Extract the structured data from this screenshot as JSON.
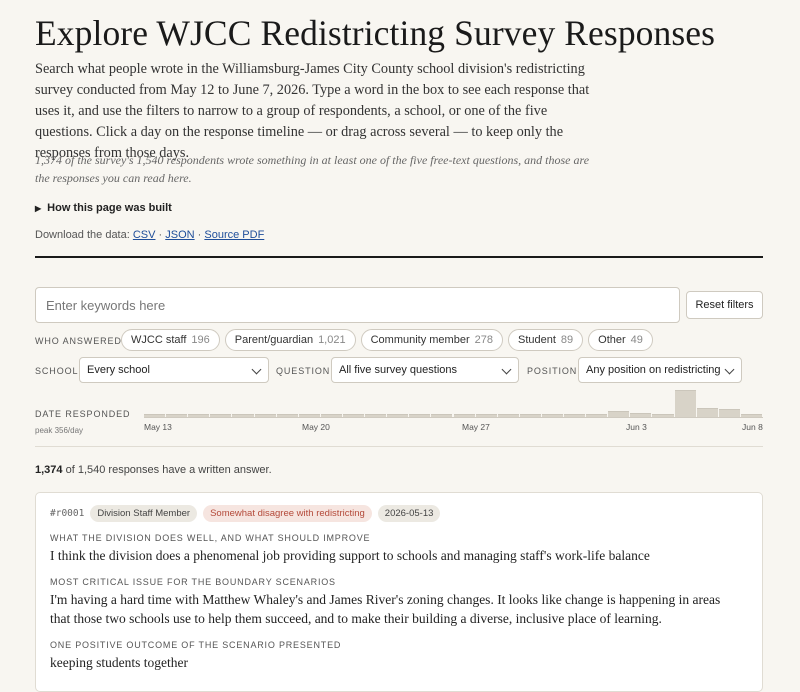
{
  "header": {
    "title": "Explore WJCC Redistricting Survey Responses",
    "intro": "Search what people wrote in the Williamsburg-James City County school division's redistricting survey conducted from May 12 to June 7, 2026. Type a word in the box to see each response that uses it, and use the filters to narrow to a group of respondents, a school, or one of the five questions. Click a day on the response timeline — or drag across several — to keep only the responses from those days.",
    "note": "1,374 of the survey's 1,540 respondents wrote something in at least one of the five free-text questions, and those are the responses you can read here.",
    "how_built": "How this page was built",
    "download_prefix": "Download the data:",
    "download_links": [
      "CSV",
      "JSON",
      "Source PDF"
    ],
    "download_sep": " · "
  },
  "search": {
    "placeholder": "Enter keywords here",
    "value": "",
    "reset_label": "Reset filters"
  },
  "filters": {
    "who_label": "WHO ANSWERED",
    "who_chips": [
      {
        "label": "WJCC staff",
        "count": "196"
      },
      {
        "label": "Parent/guardian",
        "count": "1,021"
      },
      {
        "label": "Community member",
        "count": "278"
      },
      {
        "label": "Student",
        "count": "89"
      },
      {
        "label": "Other",
        "count": "49"
      }
    ],
    "school_label": "SCHOOL",
    "school_value": "Every school",
    "question_label": "QUESTION",
    "question_value": "All five survey questions",
    "position_label": "POSITION",
    "position_value": "Any position on redistricting"
  },
  "timeline": {
    "label": "DATE RESPONDED",
    "peak": "peak 356/day",
    "ticks": [
      "May 13",
      "May 20",
      "May 27",
      "Jun 3",
      "Jun 8"
    ],
    "daily_counts": [
      20,
      30,
      20,
      20,
      20,
      20,
      20,
      20,
      20,
      20,
      20,
      20,
      20,
      20,
      20,
      20,
      20,
      20,
      20,
      20,
      20,
      70,
      45,
      20,
      300,
      100,
      90,
      30
    ]
  },
  "results": {
    "count": "1,374",
    "count_suffix": "of 1,540 responses have a written answer."
  },
  "card": {
    "id": "#r0001",
    "role": "Division Staff Member",
    "position": "Somewhat disagree with redistricting",
    "date": "2026-05-13",
    "q1_label": "WHAT THE DIVISION DOES WELL, AND WHAT SHOULD IMPROVE",
    "q1_answer": "I think the division does a phenomenal job providing support to schools and managing staff's work-life balance",
    "q2_label": "MOST CRITICAL ISSUE FOR THE BOUNDARY SCENARIOS",
    "q2_answer": "I'm having a hard time with Matthew Whaley's and James River's zoning changes. It looks like change is happening in areas that those two schools use to help them succeed, and to make their building a diverse, inclusive place of learning.",
    "q3_label": "ONE POSITIVE OUTCOME OF THE SCENARIO PRESENTED",
    "q3_answer": "keeping students together"
  },
  "colors": {
    "background": "#f8f6f1",
    "bar": "#d8d3c8",
    "link": "#1f4e9a",
    "position_tag": "#b44a3a"
  }
}
